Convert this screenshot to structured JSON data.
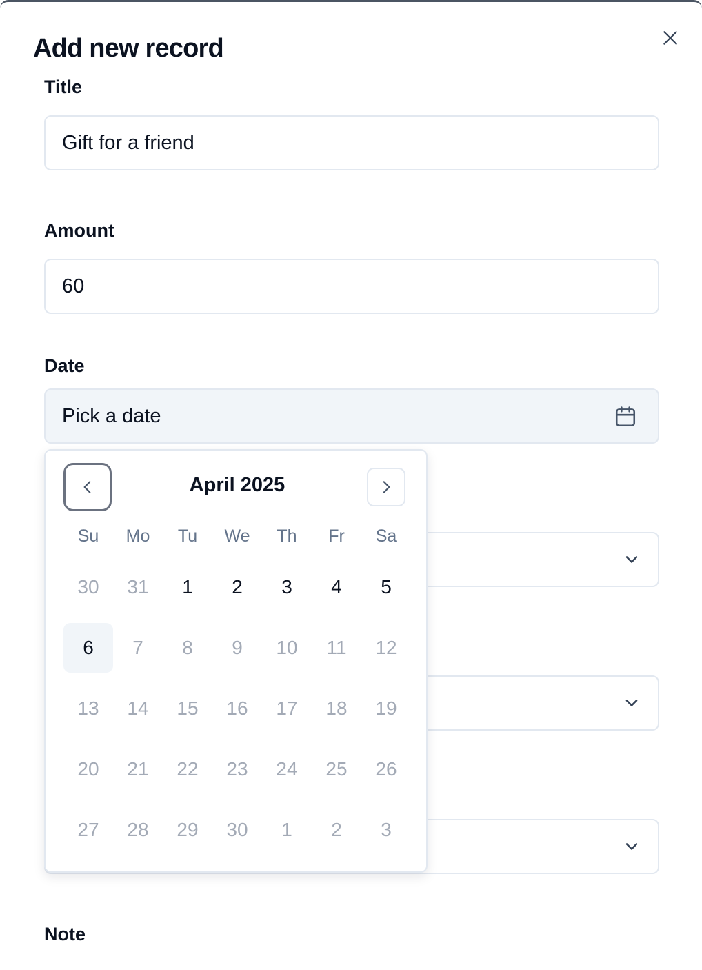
{
  "dialog": {
    "title": "Add new record",
    "close_icon": "close-icon"
  },
  "form": {
    "title": {
      "label": "Title",
      "value": "Gift for a friend"
    },
    "amount": {
      "label": "Amount",
      "value": "60"
    },
    "date": {
      "label": "Date",
      "placeholder": "Pick a date",
      "icon": "calendar-icon"
    },
    "note": {
      "label": "Note"
    },
    "select_icon": "chevron-down-icon"
  },
  "calendar": {
    "month_label": "April 2025",
    "prev_icon": "chevron-left-icon",
    "next_icon": "chevron-right-icon",
    "weekdays": [
      "Su",
      "Mo",
      "Tu",
      "We",
      "Th",
      "Fr",
      "Sa"
    ],
    "weeks": [
      [
        {
          "d": "30",
          "muted": true
        },
        {
          "d": "31",
          "muted": true
        },
        {
          "d": "1"
        },
        {
          "d": "2"
        },
        {
          "d": "3"
        },
        {
          "d": "4"
        },
        {
          "d": "5"
        }
      ],
      [
        {
          "d": "6",
          "selected": true
        },
        {
          "d": "7",
          "muted": true
        },
        {
          "d": "8",
          "muted": true
        },
        {
          "d": "9",
          "muted": true
        },
        {
          "d": "10",
          "muted": true
        },
        {
          "d": "11",
          "muted": true
        },
        {
          "d": "12",
          "muted": true
        }
      ],
      [
        {
          "d": "13",
          "muted": true
        },
        {
          "d": "14",
          "muted": true
        },
        {
          "d": "15",
          "muted": true
        },
        {
          "d": "16",
          "muted": true
        },
        {
          "d": "17",
          "muted": true
        },
        {
          "d": "18",
          "muted": true
        },
        {
          "d": "19",
          "muted": true
        }
      ],
      [
        {
          "d": "20",
          "muted": true
        },
        {
          "d": "21",
          "muted": true
        },
        {
          "d": "22",
          "muted": true
        },
        {
          "d": "23",
          "muted": true
        },
        {
          "d": "24",
          "muted": true
        },
        {
          "d": "25",
          "muted": true
        },
        {
          "d": "26",
          "muted": true
        }
      ],
      [
        {
          "d": "27",
          "muted": true
        },
        {
          "d": "28",
          "muted": true
        },
        {
          "d": "29",
          "muted": true
        },
        {
          "d": "30",
          "muted": true
        },
        {
          "d": "1",
          "muted": true
        },
        {
          "d": "2",
          "muted": true
        },
        {
          "d": "3",
          "muted": true
        }
      ]
    ]
  },
  "colors": {
    "text": "#0b1220",
    "muted": "#a3aab6",
    "border": "#e2e8f0",
    "selected_bg": "#f1f5f9"
  }
}
